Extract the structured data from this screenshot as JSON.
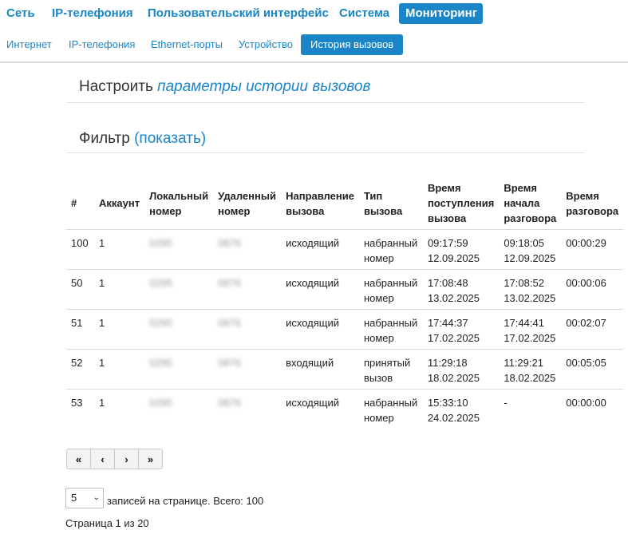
{
  "top_nav": [
    {
      "label": "Сеть",
      "active": false
    },
    {
      "label": "IP-телефония",
      "active": false
    },
    {
      "label": "Пользовательский интерфейс",
      "active": false
    },
    {
      "label": "Система",
      "active": false
    },
    {
      "label": "Мониторинг",
      "active": true
    }
  ],
  "sub_nav": [
    {
      "label": "Интернет",
      "active": false
    },
    {
      "label": "IP-телефония",
      "active": false
    },
    {
      "label": "Ethernet-порты",
      "active": false
    },
    {
      "label": "Устройство",
      "active": false
    },
    {
      "label": "История вызовов",
      "active": true
    }
  ],
  "settings": {
    "prefix": "Настроить ",
    "link": "параметры истории вызовов"
  },
  "filter": {
    "prefix": "Фильтр ",
    "link": "(показать)"
  },
  "table": {
    "headers": [
      "#",
      "Аккаунт",
      "Локальный номер",
      "Удаленный номер",
      "Направление вызова",
      "Тип вызова",
      "Время поступления вызова",
      "Время начала разговора",
      "Время разговора"
    ],
    "rows": [
      {
        "num": "100",
        "account": "1",
        "local": "0295",
        "remote": "0876",
        "direction": "исходящий",
        "type": "набранный номер",
        "received": "09:17:59 12.09.2025",
        "started": "09:18:05 12.09.2025",
        "duration": "00:00:29"
      },
      {
        "num": "50",
        "account": "1",
        "local": "0295",
        "remote": "0876",
        "direction": "исходящий",
        "type": "набранный номер",
        "received": "17:08:48 13.02.2025",
        "started": "17:08:52 13.02.2025",
        "duration": "00:00:06"
      },
      {
        "num": "51",
        "account": "1",
        "local": "0295",
        "remote": "0876",
        "direction": "исходящий",
        "type": "набранный номер",
        "received": "17:44:37 17.02.2025",
        "started": "17:44:41 17.02.2025",
        "duration": "00:02:07"
      },
      {
        "num": "52",
        "account": "1",
        "local": "0295",
        "remote": "0876",
        "direction": "входящий",
        "type": "принятый вызов",
        "received": "11:29:18 18.02.2025",
        "started": "11:29:21 18.02.2025",
        "duration": "00:05:05"
      },
      {
        "num": "53",
        "account": "1",
        "local": "0295",
        "remote": "0876",
        "direction": "исходящий",
        "type": "набранный номер",
        "received": "15:33:10 24.02.2025",
        "started": "-",
        "duration": "00:00:00"
      }
    ]
  },
  "pager": {
    "first": "«",
    "prev": "‹",
    "next": "›",
    "last": "»"
  },
  "page_size": {
    "value": "5"
  },
  "records_text": "записей на странице. Всего: 100",
  "page_info": "Страница 1 из 20"
}
